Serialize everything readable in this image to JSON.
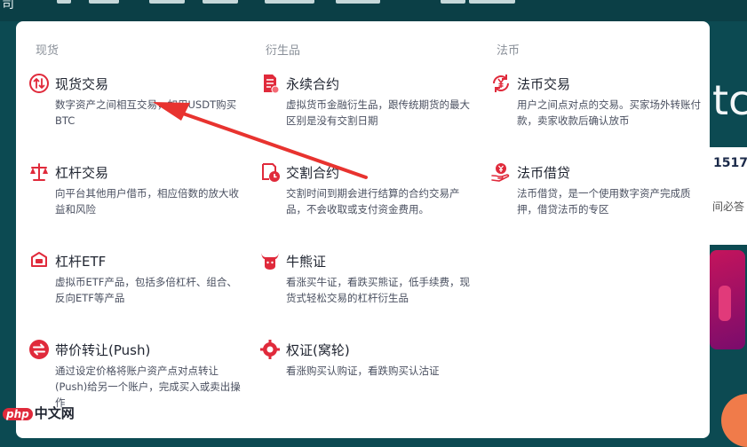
{
  "nav": {
    "brand_fragment": "司"
  },
  "background": {
    "big_text": "tc",
    "price": "1517.",
    "text": "间必答"
  },
  "columns": [
    {
      "heading": "现货"
    },
    {
      "heading": "衍生品"
    },
    {
      "heading": "法币"
    }
  ],
  "spot": [
    {
      "title": "现货交易",
      "desc": "数字资产之间相互交易，如用USDT购买BTC",
      "icon": "exchange-arrows-icon"
    },
    {
      "title": "杠杆交易",
      "desc": "向平台其他用户借币，相应倍数的放大收益和风险",
      "icon": "balance-scale-icon"
    },
    {
      "title": "杠杆ETF",
      "desc": "虚拟币ETF产品，包括多倍杠杆、组合、反向ETF等产品",
      "icon": "etf-box-icon"
    },
    {
      "title": "带价转让(Push)",
      "desc": "通过设定价格将账户资产点对点转让(Push)给另一个账户，完成买入或卖出操作",
      "icon": "transfer-icon"
    }
  ],
  "derivatives": [
    {
      "title": "永续合约",
      "desc": "虚拟货币金融衍生品，跟传统期货的最大区别是没有交割日期",
      "icon": "contract-document-icon"
    },
    {
      "title": "交割合约",
      "desc": "交割时间到期会进行结算的合约交易产品，不会收取或支付资金费用。",
      "icon": "clock-document-icon"
    },
    {
      "title": "牛熊证",
      "desc": "看涨买牛证，看跌买熊证，低手续费，现货式轻松交易的杠杆衍生品",
      "icon": "bull-icon"
    },
    {
      "title": "权证(窝轮)",
      "desc": "看涨购买认购证，看跌购买认沽证",
      "icon": "warrant-gear-icon"
    }
  ],
  "fiat": [
    {
      "title": "法币交易",
      "desc": "用户之间点对点的交易。买家场外转账付款，卖家收款后确认放币",
      "icon": "yen-exchange-icon"
    },
    {
      "title": "法币借贷",
      "desc": "法币借贷，是一个使用数字资产完成质押，借贷法币的专区",
      "icon": "yen-hand-icon"
    }
  ],
  "watermark": {
    "logo": "php",
    "text": "中文网"
  },
  "colors": {
    "accent": "#e02a3b",
    "panel": "#ffffff",
    "background": "#0c4a52"
  }
}
